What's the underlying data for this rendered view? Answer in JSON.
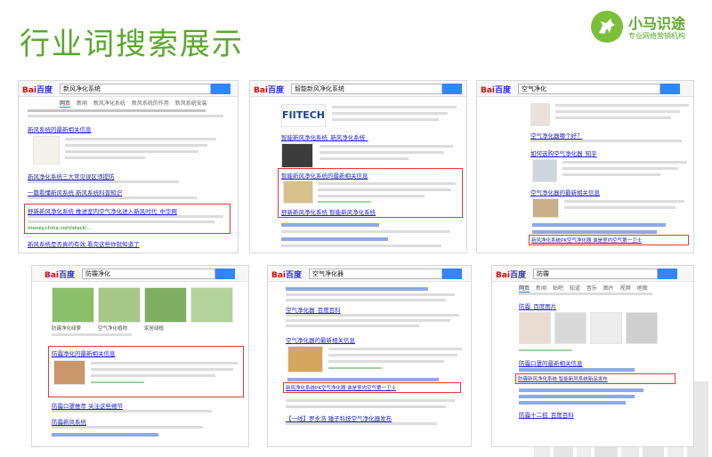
{
  "slide": {
    "title": "行业词搜索展示",
    "brand_name": "小马识途",
    "brand_slogan": "专业网络营销机构"
  },
  "search_engine": {
    "logo_text": "Bai百度",
    "logo_short": "百度"
  },
  "colors": {
    "title_green": "#59a82b",
    "highlight_red": "#e53935",
    "link_blue": "#2222cc",
    "url_green": "#008000"
  },
  "shots": [
    {
      "query": "新风净化系统",
      "tabs": [
        "网页",
        "新闻",
        "新风净化系统",
        "新风系统的作用",
        "新风系统安装"
      ],
      "results": [
        "新风系统的最新相关信息",
        "新风净化系统三大常见误区须提防",
        "一篇看懂新风系统 新风系统科普知识",
        "舒新新风净化系统 推进室内空气净化进入新风时代",
        "新风系统是否真的有效 看完这些你就知道了"
      ],
      "highlight_title": "舒新新风净化系统 推进室内空气净化进入新风时代_中华网",
      "highlight_url": "money.china.com/stock/..."
    },
    {
      "query": "智能新风净化系统",
      "brand_image_text": "FIITECH",
      "results": [
        "智能新风净化系统_新风净化系统_",
        "智能新风净化系统的最新相关信息",
        "舒新新风净化系统 智能新风净化系统"
      ],
      "highlight_title": "智能新风净化系统的最新相关信息"
    },
    {
      "query": "空气净化",
      "results": [
        "空气净化器哪个好？",
        "如何选购空气净化器_知乎",
        "空气净化器的最新相关信息"
      ],
      "highlight_title": "新风净化系统PK空气净化器 谁是室内空气第一卫士"
    },
    {
      "query": "防霾净化",
      "results": [
        "防霾净化的最新相关信息",
        "防霾口罩推荐 关注这些细节",
        "防霾新风系统"
      ],
      "highlight_title": "防霾净化的最新相关信息",
      "image_captions": [
        "防霾净化绿萝",
        "空气净化植物",
        "家居绿植"
      ]
    },
    {
      "query": "空气净化器",
      "results": [
        "空气净化器_百度百科",
        "空气净化器的最新相关信息",
        "【一线】罗永浩 锤子科技空气净化器发布"
      ],
      "highlight_title": "新风净化系统PK空气净化器 谁是室内空气第一卫士"
    },
    {
      "query": "防霾",
      "tabs": [
        "网页",
        "新闻",
        "贴吧",
        "知道",
        "音乐",
        "图片",
        "视频",
        "地图"
      ],
      "results": [
        "防霾_百度图片",
        "防霾口罩的最新相关信息",
        "防霾十二招_百度百科"
      ],
      "highlight_title": "防霾新风净化系统 智能新风系统新品发布"
    }
  ]
}
